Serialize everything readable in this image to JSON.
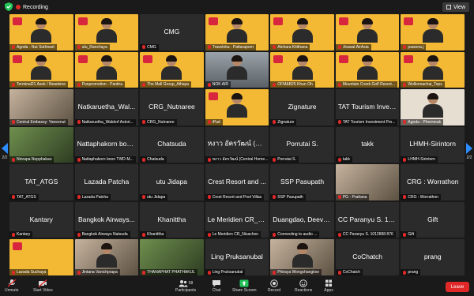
{
  "topbar": {
    "recording_label": "Recording",
    "view_label": "View"
  },
  "pager": {
    "left_page": "2/2",
    "right_page": "2/2"
  },
  "tiles": [
    {
      "big": "",
      "label": "Agoda - Nut Suthisart",
      "style": "yellow-person"
    },
    {
      "big": "",
      "label": "utu_Ranchaya",
      "style": "yellow-person"
    },
    {
      "big": "CMG",
      "label": "CMG",
      "style": "dark"
    },
    {
      "big": "",
      "label": "Traveloka - Pattaraporn",
      "style": "yellow-person"
    },
    {
      "big": "",
      "label": "Atchara Kitithana",
      "style": "yellow-person"
    },
    {
      "big": "",
      "label": "Jirawat AirAsia",
      "style": "yellow-person"
    },
    {
      "big": "",
      "label": "pawena.j",
      "style": "yellow-person"
    },
    {
      "big": "",
      "label": "Terminal21 Asok / Neadsine",
      "style": "yellow-person"
    },
    {
      "big": "",
      "label": "Punpromotion - Pantira",
      "style": "yellow-person"
    },
    {
      "big": "",
      "label": "The Mall Group_Athaya",
      "style": "yellow-person"
    },
    {
      "big": "",
      "label": "NOK AIR",
      "style": "office-person"
    },
    {
      "big": "",
      "label": "OFM&B25 Khun Oh",
      "style": "yellow-person"
    },
    {
      "big": "",
      "label": "Mountain Creek Golf Resort...",
      "style": "yellow-person"
    },
    {
      "big": "",
      "label": "Wollonnachai_Tops",
      "style": "yellow-person"
    },
    {
      "big": "",
      "label": "Central Embassy: Yaneenut",
      "style": "photo"
    },
    {
      "big": "Natkaruetha_Wal...",
      "label": "Natkaruetha_Waldorf Astori...",
      "style": "dark"
    },
    {
      "big": "CRG_Nutnaree",
      "label": "CRG_Nutnaree",
      "style": "dark"
    },
    {
      "big": "",
      "label": "iPad",
      "style": "yellow-person"
    },
    {
      "big": "Zignature",
      "label": "Zignature",
      "style": "dark"
    },
    {
      "big": "TAT Tourism Inves...",
      "label": "TAT Tourism Investment Pro...",
      "style": "dark"
    },
    {
      "big": "",
      "label": "Agoda - Phermeak",
      "style": "beige-person"
    },
    {
      "big": "",
      "label": "Ninrapa Nopphakao",
      "style": "greenphoto"
    },
    {
      "big": "Nattaphakorn boo...",
      "label": "Nattaphakorn boon TWD-M...",
      "style": "dark"
    },
    {
      "big": "Chatsuda",
      "label": "Chatsuda",
      "style": "dark"
    },
    {
      "big": "หงาว อัครวัฒน์ (Ce...",
      "label": "หงาว อัครวัฒน์ (Central Home...",
      "style": "dark"
    },
    {
      "big": "Porrutai S.",
      "label": "Porrutai S.",
      "style": "dark"
    },
    {
      "big": "takk",
      "label": "takk",
      "style": "dark"
    },
    {
      "big": "LHMH-Sirintorn",
      "label": "LHMH-Sirintorn",
      "style": "dark"
    },
    {
      "big": "TAT_ATGS",
      "label": "TAT_ATGS",
      "style": "dark"
    },
    {
      "big": "Lazada Patcha",
      "label": "Lazada Patcha",
      "style": "dark"
    },
    {
      "big": "utu Jidapa",
      "label": "utu Jidapa",
      "style": "dark"
    },
    {
      "big": "Crest Resort and ...",
      "label": "Crest Resort and Pool Villas",
      "style": "dark"
    },
    {
      "big": "SSP Pasupath",
      "label": "SSP Pasupath",
      "style": "dark"
    },
    {
      "big": "",
      "label": "PG - Prattana",
      "style": "photo"
    },
    {
      "big": "CRG : Worrathon",
      "label": "CRG : Worrathon",
      "style": "dark"
    },
    {
      "big": "Kantary",
      "label": "Kantary",
      "style": "dark"
    },
    {
      "big": "Bangkok Airways...",
      "label": "Bangkok Airways Natsuda",
      "style": "dark"
    },
    {
      "big": "Khanittha",
      "label": "Khanittha",
      "style": "dark"
    },
    {
      "big": "Le Meridien CR_N...",
      "label": "Le Meridien CR_Nisachon",
      "style": "dark"
    },
    {
      "big": "Duangdao, Deeva...",
      "label": "Connecting to audio ...",
      "style": "dark"
    },
    {
      "big": "CC Paranyu S. 101...",
      "label": "CC Paranyu S. 1012898 876",
      "style": "dark"
    },
    {
      "big": "Gift",
      "label": "Gift",
      "style": "dark"
    },
    {
      "big": "",
      "label": "Lazada Suchaya",
      "style": "yellow-plain"
    },
    {
      "big": "",
      "label": "Jintana Vanichprapa",
      "style": "photo-person"
    },
    {
      "big": "",
      "label": "THANAPHAT PHATHAKUL",
      "style": "greenphoto"
    },
    {
      "big": "Ling Pruksanubal",
      "label": "Ling Pruksanubal",
      "style": "dark"
    },
    {
      "big": "",
      "label": "Phiraya Wongchanglow",
      "style": "photo-person"
    },
    {
      "big": "CoChatch",
      "label": "CoChatch",
      "style": "dark"
    },
    {
      "big": "prang",
      "label": "prang",
      "style": "dark"
    }
  ],
  "toolbar": {
    "unmute": "Unmute",
    "start_video": "Start Video",
    "participants": "Participants",
    "participant_count": "58",
    "chat": "Chat",
    "share_screen": "Share Screen",
    "record": "Record",
    "reactions": "Reactions",
    "apps": "Apps",
    "leave": "Leave"
  },
  "colors": {
    "accent": "#2d8cff",
    "leave": "#e02828",
    "share": "#23c35a",
    "tile_yellow": "#f3b935"
  }
}
